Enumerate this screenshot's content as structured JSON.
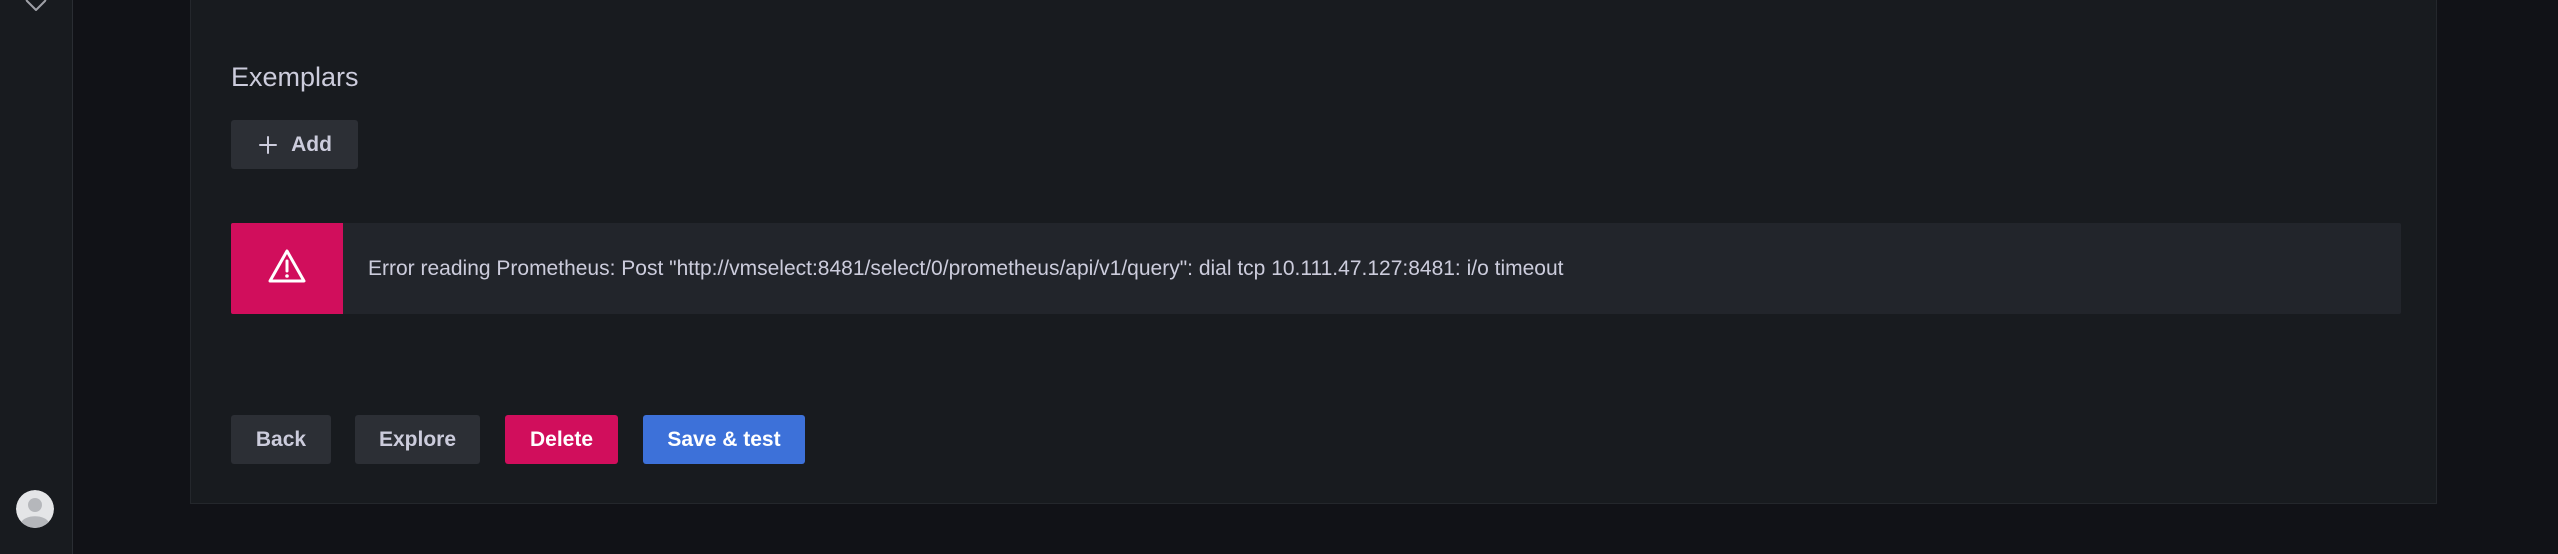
{
  "sidenav": {
    "top_icon": "heart-icon",
    "avatar_icon": "user-avatar-icon"
  },
  "exemplars": {
    "title": "Exemplars",
    "add_label": "Add",
    "add_icon": "plus-icon"
  },
  "alert": {
    "icon": "warning-triangle-icon",
    "message": "Error reading Prometheus: Post \"http://vmselect:8481/select/0/prometheus/api/v1/query\": dial tcp 10.111.47.127:8481: i/o timeout",
    "color": "#d10e5c"
  },
  "actions": {
    "back_label": "Back",
    "explore_label": "Explore",
    "delete_label": "Delete",
    "save_label": "Save & test"
  },
  "colors": {
    "primary": "#3d71d9",
    "destructive": "#d10e5c",
    "panel_bg": "#181b1f",
    "page_bg": "#111217"
  }
}
